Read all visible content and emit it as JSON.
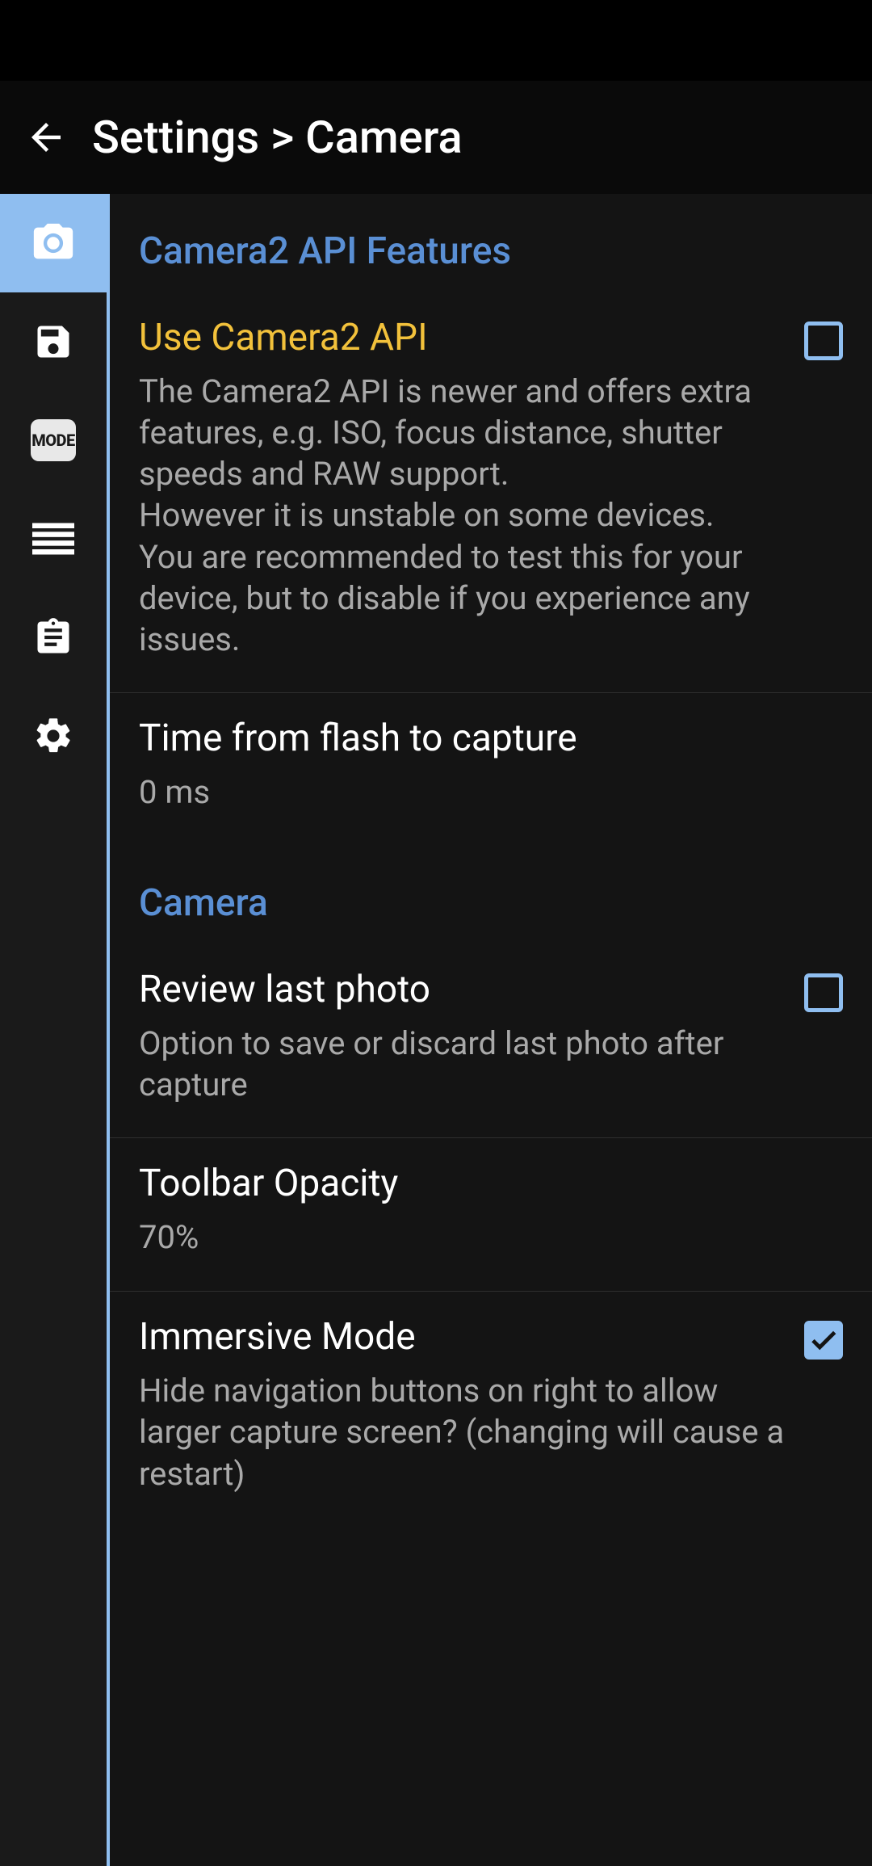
{
  "appbar": {
    "title": "Settings > Camera"
  },
  "sidebar": {
    "items": [
      {
        "name": "camera",
        "active": true
      },
      {
        "name": "save",
        "active": false
      },
      {
        "name": "mode",
        "active": false,
        "label": "MODE"
      },
      {
        "name": "list",
        "active": false
      },
      {
        "name": "clipboard",
        "active": false
      },
      {
        "name": "gear",
        "active": false
      }
    ]
  },
  "sections": [
    {
      "title": "Camera2 API Features",
      "rows": [
        {
          "title": "Use Camera2 API",
          "highlight": true,
          "desc": "The Camera2 API is newer and offers extra features, e.g. ISO, focus distance, shutter speeds and RAW support.\nHowever it is unstable on some devices.\nYou are recommended to test this for your device, but to disable if you experience any issues.",
          "checkbox": true,
          "checked": false
        },
        {
          "title": "Time from flash to capture",
          "value": "0 ms"
        }
      ]
    },
    {
      "title": "Camera",
      "rows": [
        {
          "title": "Review last photo",
          "desc": "Option to save or discard last photo after capture",
          "checkbox": true,
          "checked": false
        },
        {
          "title": "Toolbar Opacity",
          "value": "70%"
        },
        {
          "title": "Immersive Mode",
          "desc": "Hide navigation buttons on right to allow larger capture screen? (changing will cause a restart)",
          "checkbox": true,
          "checked": true,
          "noborder": true
        }
      ]
    }
  ]
}
